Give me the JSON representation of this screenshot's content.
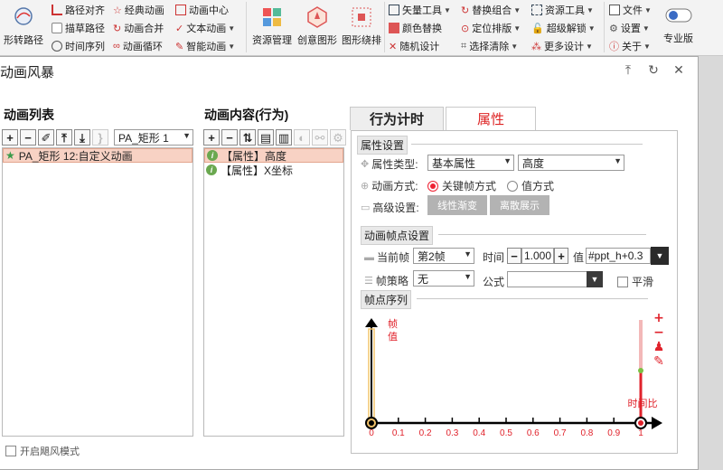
{
  "ribbon": {
    "big1_label": "形转路径",
    "col1": [
      "路径对齐",
      "描草路径",
      "时间序列"
    ],
    "col2": [
      "经典动画",
      "动画合并",
      "动画循环"
    ],
    "col3": [
      "动画中心",
      "文本动画",
      "智能动画"
    ],
    "big2_label": "资源管理",
    "big3_label": "创意图形",
    "big4_label": "图形绕排",
    "col4": [
      "矢量工具",
      "颜色替换",
      "随机设计"
    ],
    "col5": [
      "替换组合",
      "定位排版",
      "选择清除"
    ],
    "col6": [
      "资源工具",
      "超级解锁",
      "更多设计"
    ],
    "col7": [
      "文件",
      "设置",
      "关于"
    ],
    "big5_label": "专业版"
  },
  "dialog": {
    "title": "动画风暴",
    "anim_list_title": "动画列表",
    "anim_content_title": "动画内容(行为)",
    "shape_select": "PA_矩形 1",
    "anim_items": [
      "PA_矩形 12:自定义动画"
    ],
    "content_items": [
      "【属性】高度",
      "【属性】X坐标"
    ],
    "storm_mode_label": "开启飓风模式",
    "tab_timing": "行为计时",
    "tab_props": "属性",
    "props": {
      "section1": "属性设置",
      "prop_type_label": "属性类型:",
      "prop_type_value": "基本属性",
      "prop_name_value": "高度",
      "anim_mode_label": "动画方式:",
      "mode_keyframe": "关键帧方式",
      "mode_value": "值方式",
      "advanced_label": "高级设置:",
      "btn_linear": "线性渐变",
      "btn_discrete": "离散展示",
      "section2": "动画帧点设置",
      "current_frame_label": "当前帧",
      "current_frame_value": "第2帧",
      "time_label": "时间",
      "time_value": "1.000",
      "value_label": "值",
      "value_value": "#ppt_h+0.3",
      "frame_strategy_label": "帧策略",
      "frame_strategy_value": "无",
      "formula_label": "公式",
      "formula_value": "",
      "smooth_label": "平滑",
      "section3": "帧点序列"
    }
  },
  "chart_data": {
    "type": "line",
    "ylabel": "帧值",
    "xlabel": "时间比",
    "x_ticks": [
      "0",
      "0.1",
      "0.2",
      "0.3",
      "0.4",
      "0.5",
      "0.6",
      "0.7",
      "0.8",
      "0.9",
      "1"
    ],
    "keyframes": [
      0,
      1
    ],
    "xlim": [
      0,
      1
    ],
    "accent": "#e0222b",
    "line_color": "#f2c36b"
  }
}
